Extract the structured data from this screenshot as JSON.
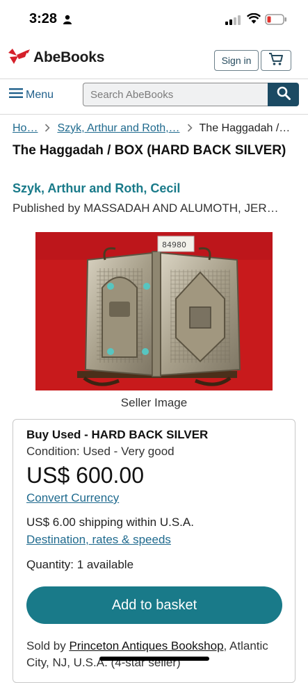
{
  "status_bar": {
    "time": "3:28",
    "icons": [
      "person-icon",
      "signal-icon",
      "wifi-icon",
      "battery-low-icon"
    ],
    "battery_color": "#e0312b"
  },
  "header": {
    "logo_text": "AbeBooks",
    "logo_color": "#d5202a",
    "sign_in_label": "Sign in",
    "cart_icon": "cart-icon"
  },
  "search": {
    "menu_label": "Menu",
    "placeholder": "Search AbeBooks",
    "button_icon": "search-icon",
    "button_color": "#1b4a63"
  },
  "breadcrumb": {
    "items": [
      "Ho…",
      "Szyk, Arthur and Roth,…",
      "The Haggadah /…"
    ]
  },
  "product": {
    "title": "The Haggadah / BOX (HARD BACK SILVER)",
    "author": "Szyk, Arthur and Roth, Cecil",
    "publisher": "Published by MASSADAH AND ALUMOTH, JER…",
    "image_tag": "84980",
    "image_caption": "Seller Image"
  },
  "buy_box": {
    "title": "Buy Used - HARD BACK SILVER",
    "condition": "Condition: Used - Very good",
    "price": "US$ 600.00",
    "convert_label": "Convert Currency",
    "shipping": "US$ 6.00 shipping within U.S.A.",
    "destination_label": "Destination, rates & speeds",
    "quantity": "Quantity: 1 available",
    "add_button_label": "Add to basket",
    "accent_color": "#197a89",
    "sold_by_prefix": "Sold by ",
    "seller_name": "Princeton Antiques Bookshop",
    "seller_location": ", Atlantic City, NJ, U.S.A. (4-star seller)"
  }
}
